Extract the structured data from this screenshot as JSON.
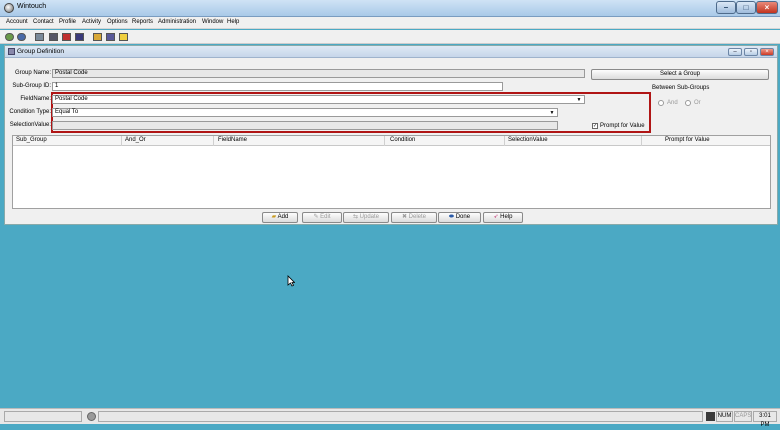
{
  "window": {
    "title": "Wintouch"
  },
  "menu": [
    "Account",
    "Contact",
    "Profile",
    "Activity",
    "Options",
    "Reports",
    "Administration",
    "Window",
    "Help"
  ],
  "inner_window": {
    "title": "Group Definition"
  },
  "form": {
    "group_name_label": "Group Name:",
    "group_name_value": "Postal Code",
    "subgroup_id_label": "Sub-Group ID:",
    "subgroup_id_value": "1",
    "fieldname_label": "FieldName:",
    "fieldname_value": "Postal Code",
    "condition_type_label": "Condition Type:",
    "condition_type_value": "Equal To",
    "selection_value_label": "SelectionValue:",
    "selection_value_value": "",
    "prompt_for_value_label": "Prompt for Value",
    "prompt_for_value_checked": true
  },
  "right_panel": {
    "select_group_label": "Select a Group",
    "between_subgroups_label": "Between Sub-Groups",
    "and_label": "And",
    "or_label": "Or"
  },
  "grid": {
    "columns": [
      "Sub_Group",
      "And_Or",
      "FieldName",
      "Condition",
      "SelectionValue",
      "Prompt for Value"
    ]
  },
  "buttons": {
    "add": "Add",
    "edit": "Edit",
    "update": "Update",
    "delete": "Delete",
    "done": "Done",
    "help": "Help"
  },
  "status": {
    "num": "NUM",
    "caps": "CAPS",
    "time": "3:01 PM"
  },
  "colors": {
    "desktop": "#4ba9c4",
    "highlight_box": "#b01515"
  }
}
